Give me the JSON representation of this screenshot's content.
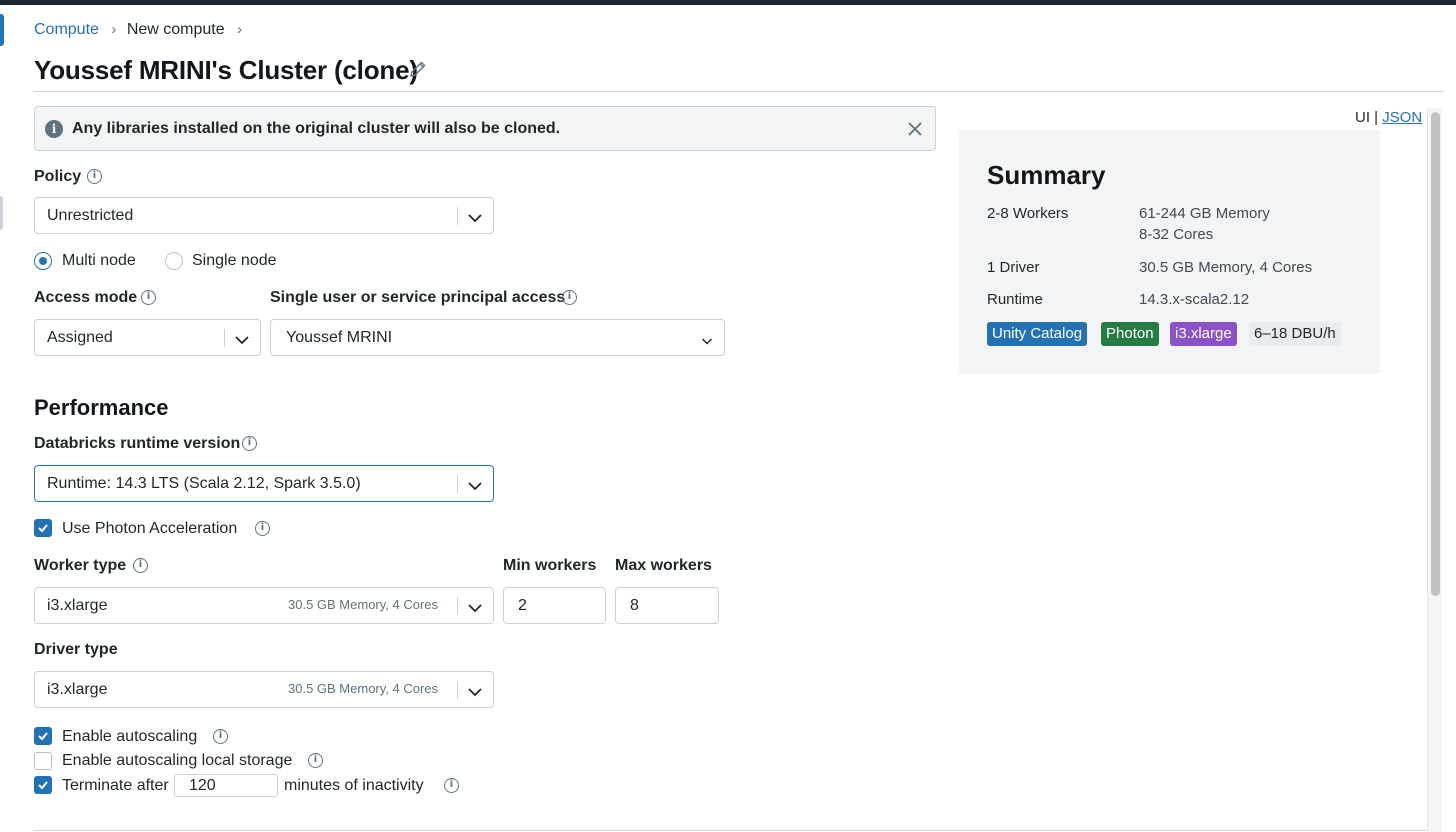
{
  "breadcrumb": {
    "compute": "Compute",
    "new_compute": "New compute",
    "separator": "›"
  },
  "page": {
    "title": "Youssef MRINI's Cluster (clone)"
  },
  "banner": {
    "text": "Any libraries installed on the original cluster will also be cloned.",
    "icon": "info-icon"
  },
  "view_toggle": {
    "ui": "UI",
    "sep": "|",
    "json": "JSON"
  },
  "policy": {
    "label": "Policy",
    "value": "Unrestricted"
  },
  "node_mode": {
    "multi": "Multi node",
    "single": "Single node",
    "selected": "multi"
  },
  "access_mode": {
    "label": "Access mode",
    "value": "Assigned"
  },
  "single_user": {
    "label": "Single user or service principal access",
    "value": "Youssef MRINI"
  },
  "performance": {
    "heading": "Performance",
    "runtime_label": "Databricks runtime version",
    "runtime_value": "Runtime: 14.3 LTS (Scala 2.12, Spark 3.5.0)",
    "photon_label": "Use Photon Acceleration",
    "photon_checked": true
  },
  "worker": {
    "label": "Worker type",
    "value": "i3.xlarge",
    "detail": "30.5 GB Memory, 4 Cores",
    "min_label": "Min workers",
    "min_value": "2",
    "max_label": "Max workers",
    "max_value": "8"
  },
  "driver": {
    "label": "Driver type",
    "value": "i3.xlarge",
    "detail": "30.5 GB Memory, 4 Cores"
  },
  "options": {
    "autoscaling": "Enable autoscaling",
    "autoscaling_checked": true,
    "local_storage": "Enable autoscaling local storage",
    "local_storage_checked": false,
    "terminate_prefix": "Terminate after",
    "terminate_value": "120",
    "terminate_suffix": "minutes of inactivity",
    "terminate_checked": true
  },
  "summary": {
    "title": "Summary",
    "workers_k": "2-8 Workers",
    "workers_v1": "61-244 GB Memory",
    "workers_v2": "8-32 Cores",
    "driver_k": "1 Driver",
    "driver_v": "30.5 GB Memory, 4 Cores",
    "runtime_k": "Runtime",
    "runtime_v": "14.3.x-scala2.12",
    "tags": [
      {
        "label": "Unity Catalog",
        "color": "#2272b4"
      },
      {
        "label": "Photon",
        "color": "#277c43"
      },
      {
        "label": "i3.xlarge",
        "color": "#8b52c7"
      }
    ],
    "dbu": "6–18 DBU/h"
  },
  "colors": {
    "accent": "#2272b4",
    "banner_bg": "#f2f4f6",
    "summary_bg": "#f2f4f6"
  }
}
